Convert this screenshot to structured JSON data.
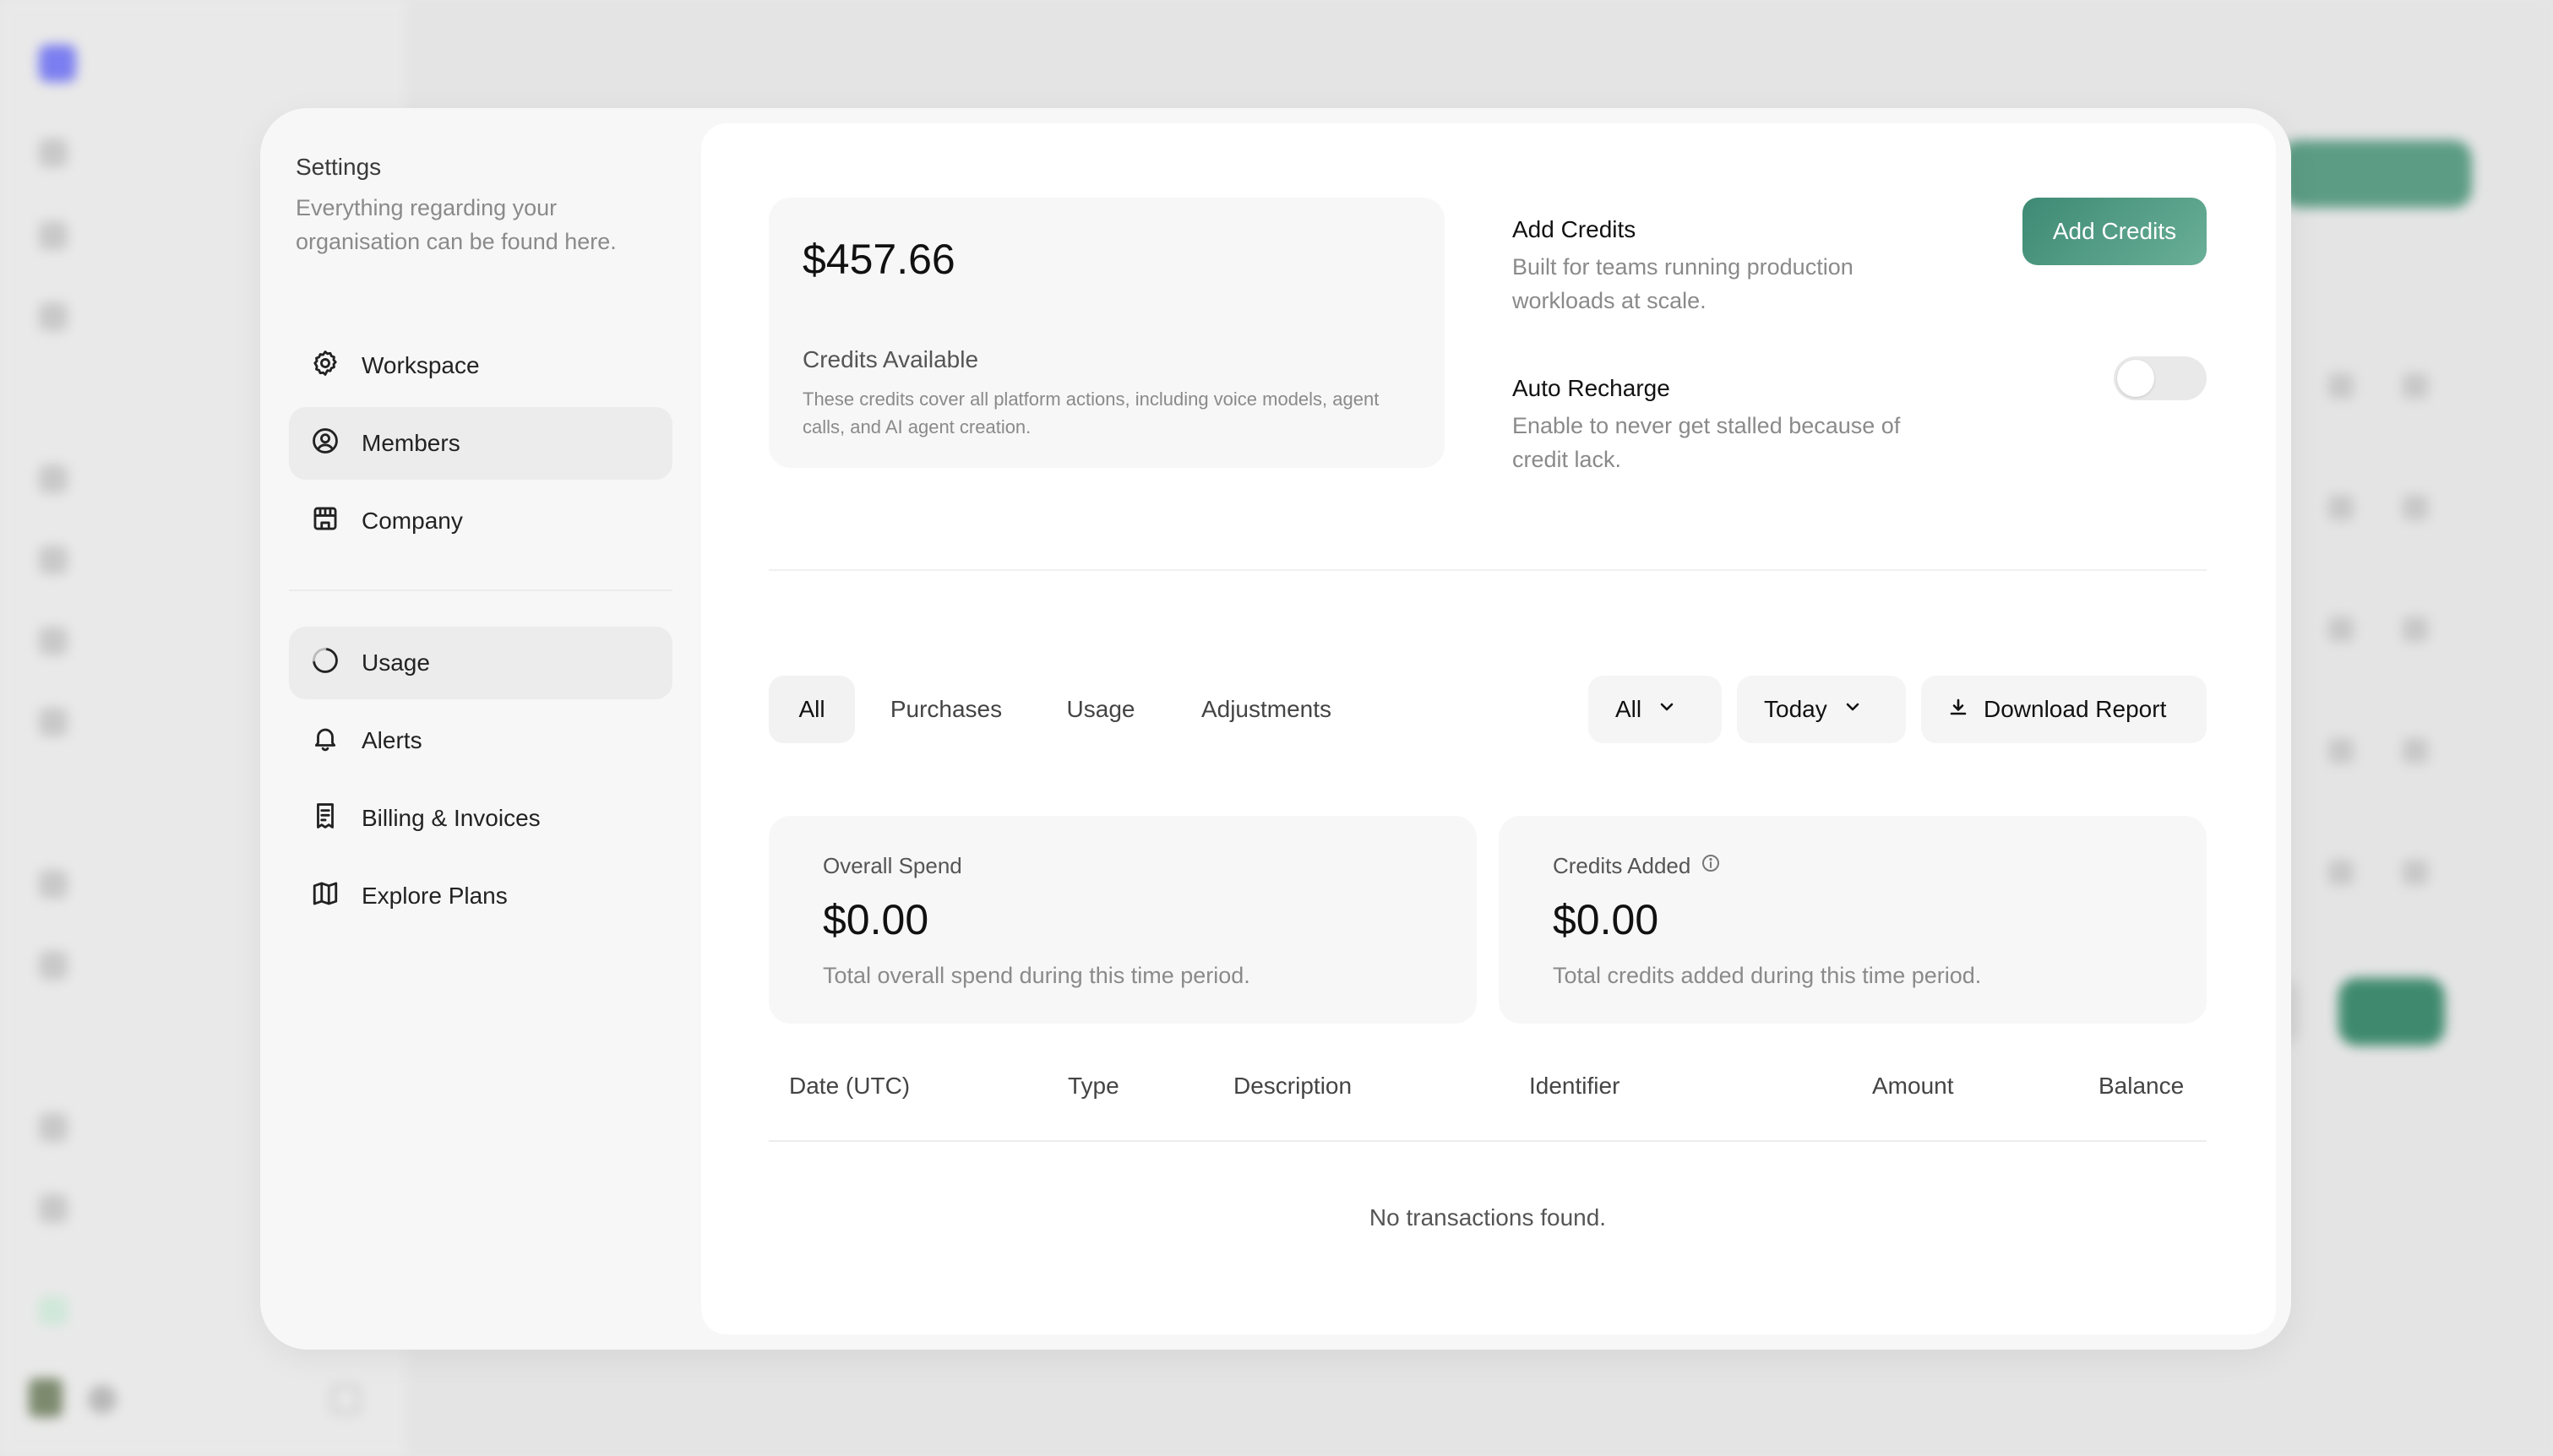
{
  "settings": {
    "title": "Settings",
    "description": "Everything regarding your organisation can be found here.",
    "nav_group1": [
      {
        "label": "Workspace",
        "icon": "gear-icon"
      },
      {
        "label": "Members",
        "icon": "user-circle-icon"
      },
      {
        "label": "Company",
        "icon": "store-icon"
      }
    ],
    "nav_group2": [
      {
        "label": "Usage",
        "icon": "pie-loader-icon"
      },
      {
        "label": "Alerts",
        "icon": "bell-icon"
      },
      {
        "label": "Billing & Invoices",
        "icon": "receipt-icon"
      },
      {
        "label": "Explore Plans",
        "icon": "map-icon"
      }
    ]
  },
  "balance": {
    "amount": "$457.66",
    "label": "Credits Available",
    "description": "These credits cover all platform actions, including voice models, agent calls, and AI agent creation."
  },
  "add_credits": {
    "title": "Add Credits",
    "description": "Built for teams running production workloads at scale.",
    "button": "Add Credits"
  },
  "auto_recharge": {
    "title": "Auto Recharge",
    "description": "Enable to never get stalled because of credit lack.",
    "enabled": false
  },
  "tabs": [
    "All",
    "Purchases",
    "Usage",
    "Adjustments"
  ],
  "filters": {
    "type": "All",
    "range": "Today",
    "download": "Download Report"
  },
  "stats": {
    "overall_spend": {
      "label": "Overall Spend",
      "value": "$0.00",
      "description": "Total overall spend during this time period."
    },
    "credits_added": {
      "label": "Credits Added",
      "value": "$0.00",
      "description": "Total credits added during this time period."
    }
  },
  "table": {
    "columns": [
      "Date (UTC)",
      "Type",
      "Description",
      "Identifier",
      "Amount",
      "Balance"
    ],
    "empty": "No transactions found."
  },
  "colors": {
    "accent": "#3e8a74",
    "accent_light": "#6aaf97"
  }
}
